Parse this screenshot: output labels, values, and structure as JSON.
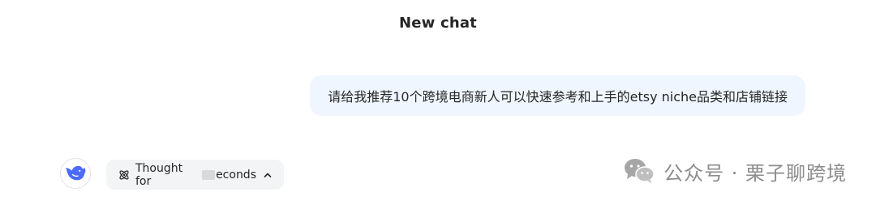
{
  "header": {
    "title": "New chat"
  },
  "messages": {
    "user_text": "请给我推荐10个跨境电商新人可以快速参考和上手的etsy niche品类和店铺链接"
  },
  "assistant": {
    "avatar_icon": "deepseek-whale-icon",
    "thought_prefix": "Thought for ",
    "thought_suffix": "econds",
    "thought_icon": "atom-icon",
    "toggle_icon": "chevron-up-icon"
  },
  "watermark": {
    "icon": "wechat-icon",
    "text": "公众号 · 栗子聊跨境"
  },
  "colors": {
    "bubble_bg": "#eff6ff",
    "chip_bg": "#f3f4f6",
    "brand": "#4d6bfe",
    "watermark": "#8c8c8c"
  }
}
